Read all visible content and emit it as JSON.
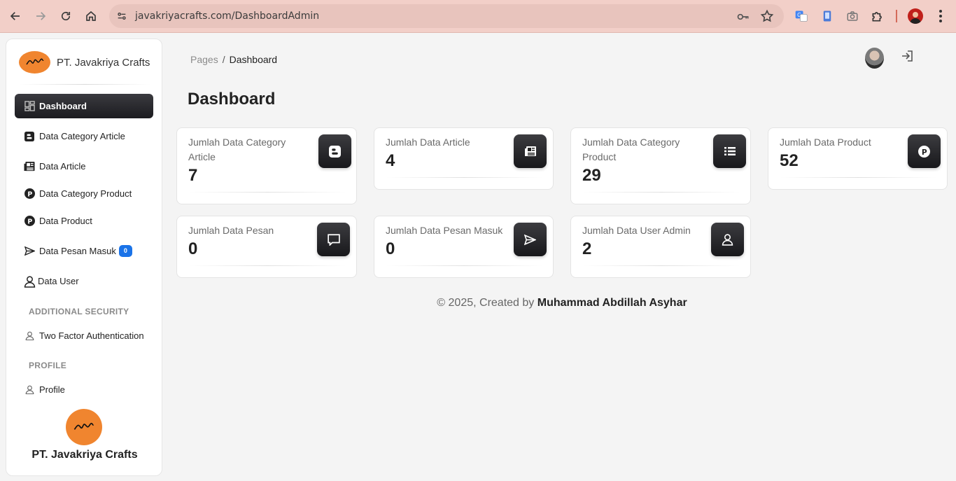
{
  "browser": {
    "url": "javakriyacrafts.com/DashboardAdmin"
  },
  "sidebar": {
    "brand_name": "PT. Javakriya Crafts",
    "items": [
      {
        "label": "Dashboard",
        "icon": "dashboard-grid-icon",
        "active": true
      },
      {
        "label": "Data Category Article",
        "icon": "blogger-icon"
      },
      {
        "label": "Data Article",
        "icon": "newspaper-icon"
      },
      {
        "label": "Data Category Product",
        "icon": "product-p-icon"
      },
      {
        "label": "Data Product",
        "icon": "product-p-icon"
      },
      {
        "label": "Data Pesan Masuk",
        "icon": "send-icon",
        "badge": "0"
      },
      {
        "label": "Data User",
        "icon": "user-icon"
      }
    ],
    "sections": {
      "security": "ADDITIONAL SECURITY",
      "security_item": "Two Factor Authentication",
      "profile": "PROFILE",
      "profile_item": "Profile"
    },
    "footer_brand": "PT. Javakriya Crafts"
  },
  "header": {
    "breadcrumb_root": "Pages",
    "breadcrumb_sep": "/",
    "breadcrumb_current": "Dashboard",
    "title": "Dashboard"
  },
  "cards": [
    {
      "label": "Jumlah Data Category Article",
      "value": "7",
      "icon": "blogger-icon"
    },
    {
      "label": "Jumlah Data Article",
      "value": "4",
      "icon": "newspaper-icon"
    },
    {
      "label": "Jumlah Data Category Product",
      "value": "29",
      "icon": "list-icon"
    },
    {
      "label": "Jumlah Data Product",
      "value": "52",
      "icon": "product-p-icon"
    },
    {
      "label": "Jumlah Data Pesan",
      "value": "0",
      "icon": "message-icon"
    },
    {
      "label": "Jumlah Data Pesan Masuk",
      "value": "0",
      "icon": "send-icon"
    },
    {
      "label": "Jumlah Data User Admin",
      "value": "2",
      "icon": "user-icon"
    }
  ],
  "footer": {
    "prefix": "© 2025, Created by ",
    "author": "Muhammad Abdillah Asyhar"
  },
  "colors": {
    "chrome": "#f2cfc8",
    "accent_dark": "#1c1c20",
    "badge_blue": "#1a73e8",
    "logo_orange": "#f0852f"
  }
}
